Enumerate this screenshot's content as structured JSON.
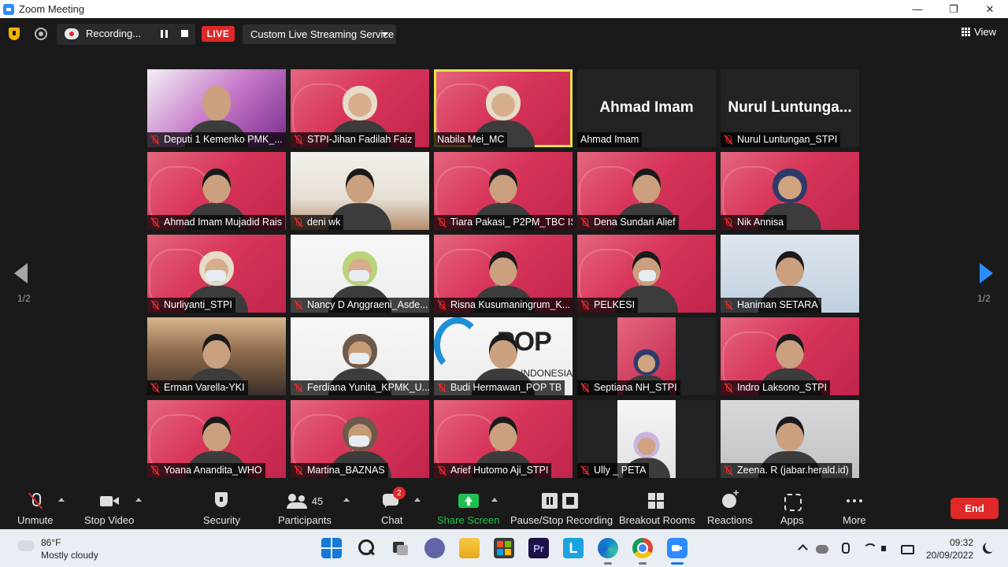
{
  "window": {
    "title": "Zoom Meeting",
    "controls": [
      "—",
      "❐",
      "✕"
    ]
  },
  "topbar": {
    "recording_label": "Recording...",
    "live_label": "LIVE",
    "streaming_service": "Custom Live Streaming Service",
    "view_label": "View"
  },
  "gallery": {
    "page_left": "1/2",
    "page_right": "1/2",
    "tiles": [
      {
        "name": "Deputi 1 Kemenko PMK_...",
        "muted": true,
        "bg": "bg-purple",
        "person": "default"
      },
      {
        "name": "STPI-Jihan Fadilah Faiz",
        "muted": true,
        "bg": "bg-pink",
        "person": "hijab-cream"
      },
      {
        "name": "Nabila Mei_MC",
        "muted": false,
        "bg": "bg-pink",
        "person": "hijab-cream",
        "active": true
      },
      {
        "name": "Ahmad Imam",
        "muted": false,
        "bg": "bg-dark",
        "big_name": "Ahmad Imam"
      },
      {
        "name": "Nurul Luntungan_STPI",
        "muted": true,
        "bg": "bg-dark",
        "big_name": "Nurul  Luntunga..."
      },
      {
        "name": "Ahmad Imam Mujadid Rais",
        "muted": true,
        "bg": "bg-pink",
        "person": "dark-hair"
      },
      {
        "name": "deni wk",
        "muted": true,
        "bg": "bg-room",
        "person": "dark-hair"
      },
      {
        "name": "Tiara Pakasi_ P2PM_TBC ISPA",
        "muted": true,
        "bg": "bg-pink",
        "person": "dark-hair"
      },
      {
        "name": "Dena Sundari Alief",
        "muted": true,
        "bg": "bg-pink",
        "person": "dark-hair"
      },
      {
        "name": "Nik Annisa",
        "muted": true,
        "bg": "bg-pink",
        "person": "hijab-navy"
      },
      {
        "name": "Nurliyanti_STPI",
        "muted": true,
        "bg": "bg-pink",
        "person": "hijab-cream mask"
      },
      {
        "name": "Nancy D Anggraeni_Asde...",
        "muted": true,
        "bg": "bg-white",
        "person": "hijab-green mask"
      },
      {
        "name": "Risna Kusumaningrum_K...",
        "muted": true,
        "bg": "bg-pink",
        "person": "dark-hair"
      },
      {
        "name": "PELKESI",
        "muted": true,
        "bg": "bg-pink",
        "person": "dark-hair mask"
      },
      {
        "name": "Haniman SETARA",
        "muted": true,
        "bg": "bg-blue-wall",
        "person": "dark-hair"
      },
      {
        "name": "Erman Varella-YKI",
        "muted": true,
        "bg": "bg-sunset",
        "person": "dark-hair"
      },
      {
        "name": "Ferdiana Yunita_KPMK_U...",
        "muted": true,
        "bg": "bg-white",
        "person": "hijab-brown mask"
      },
      {
        "name": "Budi Hermawan_POP TB",
        "muted": true,
        "bg": "bg-white",
        "person": "dark-hair",
        "logo": "POP",
        "logo_sub": "INDONESIA"
      },
      {
        "name": "Septiana NH_STPI",
        "muted": true,
        "bg": "bg-dark",
        "person": "hijab-navy",
        "inset": true
      },
      {
        "name": "Indro Laksono_STPI",
        "muted": true,
        "bg": "bg-pink",
        "person": "dark-hair"
      },
      {
        "name": "Yoana Anandita_WHO",
        "muted": true,
        "bg": "bg-pink",
        "person": "dark-hair"
      },
      {
        "name": "Martina_BAZNAS",
        "muted": true,
        "bg": "bg-pink",
        "person": "hijab-brown mask"
      },
      {
        "name": "Arief Hutomo Aji_STPI",
        "muted": true,
        "bg": "bg-pink",
        "person": "dark-hair"
      },
      {
        "name": "Ully _ PETA",
        "muted": true,
        "bg": "bg-dark",
        "person": "hijab-lav",
        "inset": true
      },
      {
        "name": "Zeena. R (jabar.herald.id)",
        "muted": true,
        "bg": "bg-gray",
        "person": "dark-hair"
      }
    ]
  },
  "toolbar": {
    "unmute": "Unmute",
    "stop_video": "Stop Video",
    "security": "Security",
    "participants_count": "45",
    "participants": "Participants",
    "chat_badge": "2",
    "chat": "Chat",
    "share_screen": "Share Screen",
    "pause_stop_recording": "Pause/Stop Recording",
    "breakout_rooms": "Breakout Rooms",
    "reactions": "Reactions",
    "apps": "Apps",
    "more": "More",
    "end": "End"
  },
  "taskbar": {
    "weather_temp": "86°F",
    "weather_desc": "Mostly cloudy",
    "premiere_letter": "Pr",
    "lens_letter": "L",
    "time": "09:32",
    "date": "20/09/2022"
  },
  "colors": {
    "zoom_blue": "#2d8cff",
    "live_red": "#e02828",
    "share_green": "#1fc04e",
    "active_speaker": "#e8e04a"
  }
}
